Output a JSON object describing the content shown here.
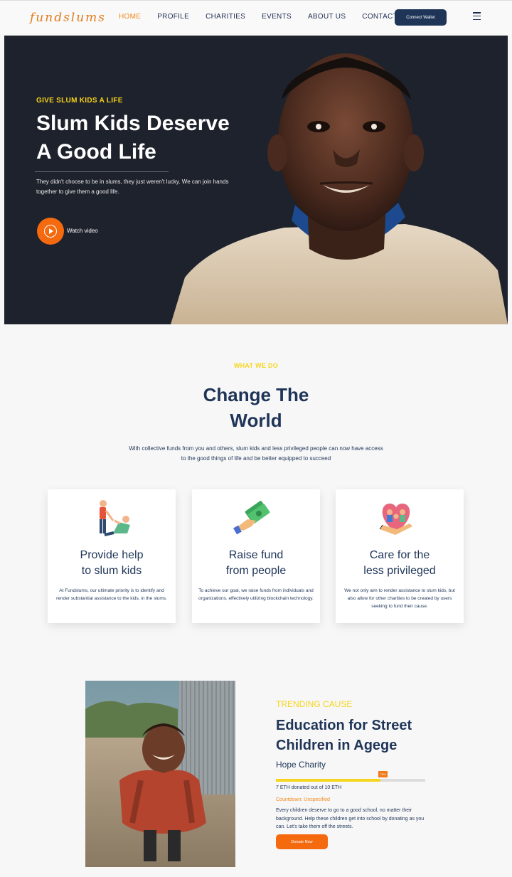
{
  "nav": {
    "logo": "fundslums",
    "links": [
      "HOME",
      "PROFILE",
      "CHARITIES",
      "EVENTS",
      "ABOUT US",
      "CONTACT"
    ],
    "active_index": 0,
    "wallet_button": "Connect Wallet",
    "menu_icon": "hamburger-icon"
  },
  "hero": {
    "eyebrow": "GIVE SLUM KIDS A LIFE",
    "title_line1": "Slum Kids Deserve",
    "title_line2": "A Good Life",
    "description": "They didn't choose to be in slums, they just weren't lucky. We can join hands together to give them a good life.",
    "watch_label": "Watch video",
    "play_icon": "play-icon"
  },
  "what_we_do": {
    "eyebrow": "WHAT WE DO",
    "title_line1": "Change The",
    "title_line2": "World",
    "description": "With collective funds from you and others, slum kids and less privileged people can now have access to the good things of life and be better equipped to succeed",
    "cards": [
      {
        "icon": "helping-hand-icon",
        "title_line1": "Provide help",
        "title_line2": "to slum kids",
        "description": "At Fundslums, our ultimate priority is to identify and render substantial assistance to the kids, in the slums."
      },
      {
        "icon": "money-hand-icon",
        "title_line1": "Raise fund",
        "title_line2": "from people",
        "description": "To achieve our goal, we raise funds from individuals and organizations, effectively utilizing blockchain technology."
      },
      {
        "icon": "care-heart-icon",
        "title_line1": "Care for the",
        "title_line2": "less privileged",
        "description": "We not only aim to render assistance to slum kids, but also allow for other charities to be created by users seeking to fund their cause."
      }
    ]
  },
  "trending": {
    "eyebrow": "TRENDING CAUSE",
    "title_line1": "Education for Street",
    "title_line2": "Children in Agege",
    "organization": "Hope Charity",
    "progress": 0.7,
    "progress_label": "70%",
    "raised_text": "7 ETH donated out of 10 ETH",
    "countdown": "Countdown: Unspecified",
    "description": "Every children deserve to go to a good school, no matter their background. Help these children get into school by donating as you can. Let's take them off the streets.",
    "donate_button": "Donate Now"
  },
  "colors": {
    "navy": "#1f3558",
    "orange": "#f56a0f",
    "yellow": "#f5d51d",
    "hero_bg": "#1e222c"
  }
}
